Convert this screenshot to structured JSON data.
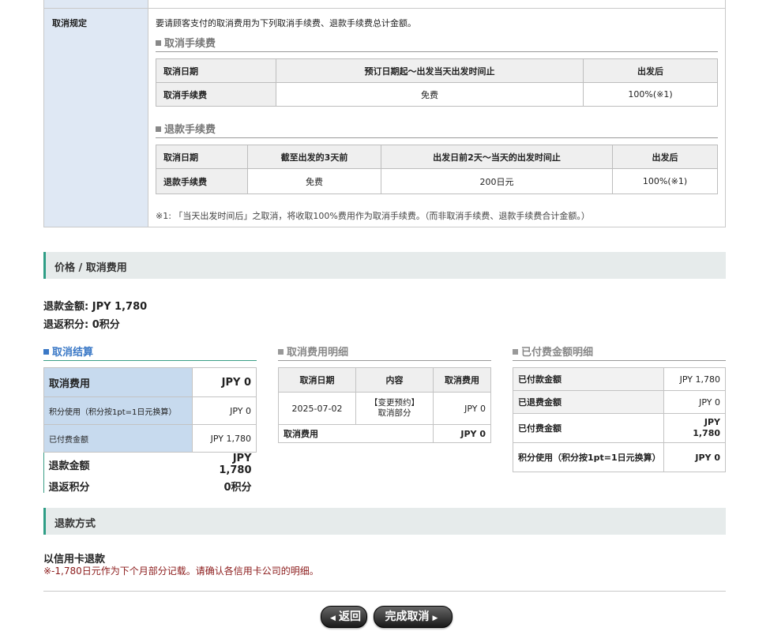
{
  "policy": {
    "side_label": "取消规定",
    "intro": "要请顾客支付的取消费用为下列取消手续费、退款手续费总计金额。",
    "cancel_fee": {
      "heading": "取消手续费",
      "header": [
        "取消日期",
        "预订日期起～出发当天出发时间止",
        "出发后"
      ],
      "row": [
        "取消手续费",
        "免费",
        "100%(※1)"
      ]
    },
    "refund_fee": {
      "heading": "退款手续费",
      "header": [
        "取消日期",
        "截至出发的3天前",
        "出发日前2天～当天的出发时间止",
        "出发后"
      ],
      "row": [
        "退款手续费",
        "免费",
        "200日元",
        "100%(※1)"
      ]
    },
    "note": "※1: 「当天出发时间后」之取消，将收取100%费用作为取消手续费。（而非取消手续费、退款手续费合计金额。）"
  },
  "price_section": {
    "title": "价格 / 取消费用",
    "refund_amount_label": "退款金额:",
    "refund_amount": "JPY 1,780",
    "refund_points_label": "退返积分:",
    "refund_points": "0积分"
  },
  "settlement": {
    "heading": "取消结算",
    "rows": [
      {
        "label": "取消费用",
        "value": "JPY 0"
      },
      {
        "label": "积分使用（积分按1pt=1日元换算）",
        "value": "JPY 0"
      },
      {
        "label": "已付费金额",
        "value": "JPY 1,780"
      }
    ],
    "refund_label": "退款金额",
    "refund_value": "JPY 1,780",
    "points_label": "退返积分",
    "points_value": "0积分"
  },
  "cancel_detail": {
    "heading": "取消费用明细",
    "header": [
      "取消日期",
      "内容",
      "取消费用"
    ],
    "row": {
      "date": "2025-07-02",
      "content_line1": "【变更预约】",
      "content_line2": "取消部分",
      "fee": "JPY 0"
    },
    "total_label": "取消费用",
    "total_value": "JPY 0"
  },
  "paid_detail": {
    "heading": "已付费金额明细",
    "rows": [
      {
        "label": "已付款金额",
        "value": "JPY 1,780"
      },
      {
        "label": "已退费金额",
        "value": "JPY 0"
      },
      {
        "label": "已付费金额",
        "value_line1": "JPY",
        "value_line2": "1,780"
      },
      {
        "label": "积分使用（积分按1pt=1日元换算）",
        "value": "JPY 0"
      }
    ]
  },
  "refund_method": {
    "title": "退款方式",
    "method": "以信用卡退款",
    "note": "※-1,780日元作为下个月部分记载。请确认各信用卡公司的明细。"
  },
  "buttons": {
    "back": "返回",
    "complete": "完成取消"
  }
}
